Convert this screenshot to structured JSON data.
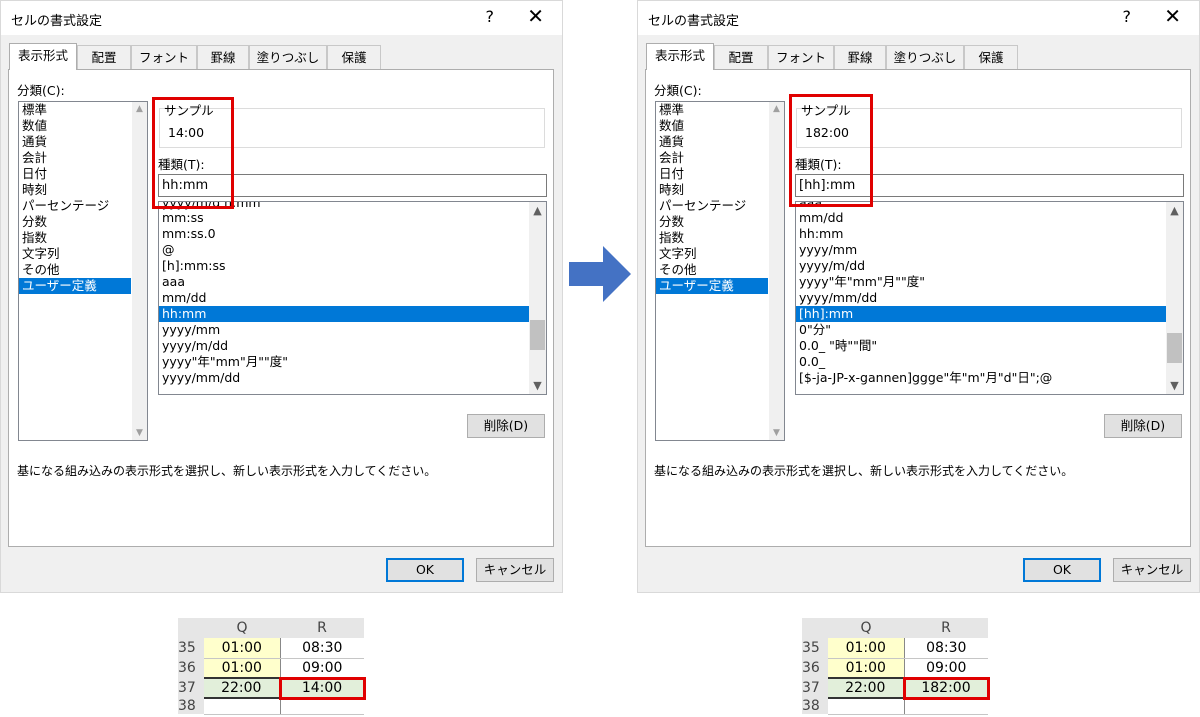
{
  "dialog_title": "セルの書式設定",
  "help_glyph": "?",
  "close_glyph": "✕",
  "tabs": [
    "表示形式",
    "配置",
    "フォント",
    "罫線",
    "塗りつぶし",
    "保護"
  ],
  "category_label": "分類(C):",
  "categories": [
    "標準",
    "数値",
    "通貨",
    "会計",
    "日付",
    "時刻",
    "パーセンテージ",
    "分数",
    "指数",
    "文字列",
    "その他",
    "ユーザー定義"
  ],
  "selected_category": "ユーザー定義",
  "sample_label": "サンプル",
  "type_label": "種類(T):",
  "delete_label": "削除(D)",
  "description": "基になる組み込みの表示形式を選択し、新しい表示形式を入力してください。",
  "ok_label": "OK",
  "cancel_label": "キャンセル",
  "before": {
    "sample_value": "14:00",
    "type_value": "hh:mm",
    "format_list": [
      "yyyy/m/d h:mm",
      "mm:ss",
      "mm:ss.0",
      "@",
      "[h]:mm:ss",
      "aaa",
      "mm/dd",
      "hh:mm",
      "yyyy/mm",
      "yyyy/m/dd",
      "yyyy\"年\"mm\"月\"\"度\"",
      "yyyy/mm/dd"
    ],
    "selected_format": "hh:mm",
    "sheet": {
      "columns": [
        "Q",
        "R"
      ],
      "rows": [
        {
          "num": "35",
          "q": "01:00",
          "r": "08:30"
        },
        {
          "num": "36",
          "q": "01:00",
          "r": "09:00"
        },
        {
          "num": "37",
          "q": "22:00",
          "r": "14:00"
        },
        {
          "num": "38",
          "q": "",
          "r": ""
        }
      ]
    }
  },
  "after": {
    "sample_value": "182:00",
    "type_value": "[hh]:mm",
    "format_list": [
      "aaa",
      "mm/dd",
      "hh:mm",
      "yyyy/mm",
      "yyyy/m/dd",
      "yyyy\"年\"mm\"月\"\"度\"",
      "yyyy/mm/dd",
      "[hh]:mm",
      "0\"分\"",
      "0.0_ \"時\"\"間\"",
      "0.0_",
      "[$-ja-JP-x-gannen]ggge\"年\"m\"月\"d\"日\";@"
    ],
    "selected_format": "[hh]:mm",
    "sheet": {
      "columns": [
        "Q",
        "R"
      ],
      "rows": [
        {
          "num": "35",
          "q": "01:00",
          "r": "08:30"
        },
        {
          "num": "36",
          "q": "01:00",
          "r": "09:00"
        },
        {
          "num": "37",
          "q": "22:00",
          "r": "182:00"
        },
        {
          "num": "38",
          "q": "",
          "r": ""
        }
      ]
    }
  },
  "colors": {
    "highlight_red": "#e00000",
    "selection_blue": "#0078d7",
    "arrow_blue": "#4472c4",
    "cell_yellow": "#ffffcc",
    "cell_green": "#e2efda"
  }
}
